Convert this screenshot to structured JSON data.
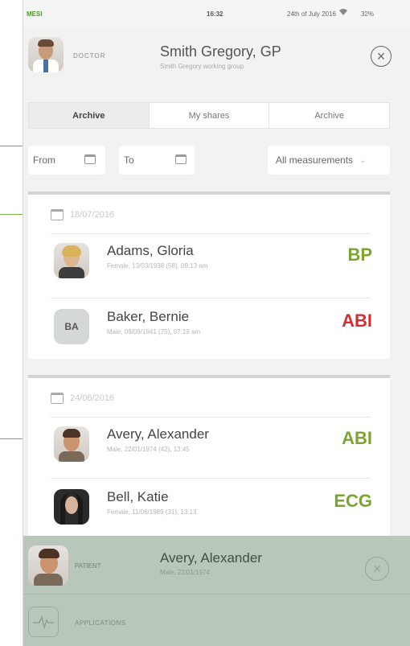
{
  "status": {
    "brand": "MESI",
    "time": "16:32",
    "date": "24th of July 2016",
    "wifi_icon": "wifi-icon",
    "battery": "32%"
  },
  "doctor": {
    "role": "DOCTOR",
    "name": "Smith Gregory, GP",
    "group": "Smith Gregory working group",
    "avatar_icon": "doctor-avatar"
  },
  "tabs": [
    {
      "label": "Archive",
      "active": true
    },
    {
      "label": "My shares",
      "active": false
    },
    {
      "label": "Archive",
      "active": false
    }
  ],
  "filters": {
    "from_label": "From",
    "to_label": "To",
    "measurement_value": "All measurements"
  },
  "groups": [
    {
      "date": "18/07/2016",
      "rows": [
        {
          "name": "Adams, Gloria",
          "meta": "Female, 13/03/1938 (58), 09:13 am",
          "type": "BP",
          "type_color": "#7aa62e",
          "initials": ""
        },
        {
          "name": "Baker, Bernie",
          "meta": "Male, 08/09/1941 (75), 07:19 am",
          "type": "ABI",
          "type_color": "#d32f2f",
          "initials": "BA"
        }
      ]
    },
    {
      "date": "24/06/2016",
      "rows": [
        {
          "name": "Avery, Alexander",
          "meta": "Male, 22/01/1974 (42), 13:45",
          "type": "ABI",
          "type_color": "#7aa62e",
          "initials": ""
        },
        {
          "name": "Bell, Katie",
          "meta": "Female, 11/06/1989 (31), 13:13",
          "type": "ECG",
          "type_color": "#7aa62e",
          "initials": ""
        }
      ]
    }
  ],
  "selected": {
    "role": "PATIENT",
    "name": "Avery, Alexander",
    "meta": "Male, 22/01/1974",
    "app_label": "APPLICATIONS"
  },
  "colors": {
    "accent": "#7cb342",
    "danger": "#d32f2f",
    "selected_bg": "#b9c7bb"
  }
}
